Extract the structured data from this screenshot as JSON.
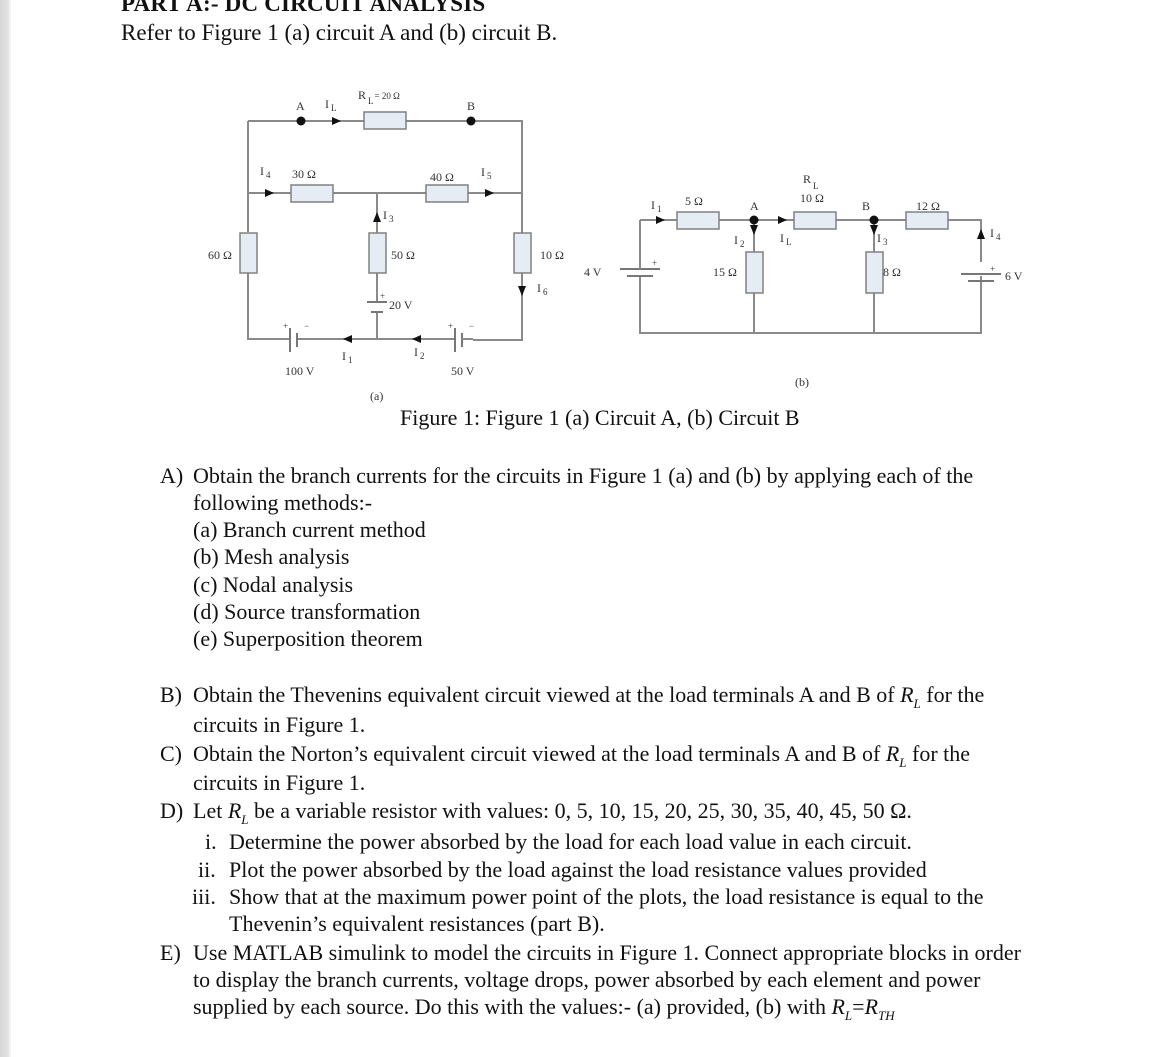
{
  "heading": "PART A:- DC CIRCUIT ANALYSIS",
  "intro": "Refer to Figure 1 (a) circuit A and (b) circuit B.",
  "figure": {
    "caption": "Figure 1: Figure 1 (a) Circuit A, (b) Circuit B",
    "circuit_a": {
      "label": "(a)",
      "nodes": {
        "a": "A",
        "b": "B"
      },
      "rl": {
        "prefix": "R",
        "sub": "L",
        "value": "= 20 Ω"
      },
      "r30": "30 Ω",
      "r40": "40 Ω",
      "r50": "50 Ω",
      "r60": "60 Ω",
      "r10": "10 Ω",
      "v20": "20 V",
      "v100": "100 V",
      "v50": "50 V",
      "currents": {
        "il": {
          "main": "I",
          "sub": "L"
        },
        "i1": {
          "main": "I",
          "sub": "1"
        },
        "i2": {
          "main": "I",
          "sub": "2"
        },
        "i3": {
          "main": "I",
          "sub": "3"
        },
        "i4": {
          "main": "I",
          "sub": "4"
        },
        "i5": {
          "main": "I",
          "sub": "5"
        },
        "i6": {
          "main": "I",
          "sub": "6"
        }
      },
      "plus": "+",
      "minus": "−"
    },
    "circuit_b": {
      "label": "(b)",
      "nodes": {
        "a": "A",
        "b": "B"
      },
      "rl": {
        "prefix": "R",
        "sub": "L",
        "value": "10 Ω"
      },
      "r5": "5 Ω",
      "r15": "15 Ω",
      "r8": "8 Ω",
      "r12": "12 Ω",
      "v4": "4 V",
      "v6": "6 V",
      "currents": {
        "i1": {
          "main": "I",
          "sub": "1"
        },
        "i2": {
          "main": "I",
          "sub": "2"
        },
        "il": {
          "main": "I",
          "sub": "L"
        },
        "i3": {
          "main": "I",
          "sub": "3"
        },
        "i4": {
          "main": "I",
          "sub": "4"
        }
      },
      "plus": "+"
    }
  },
  "questions": {
    "a": {
      "tag": "A)",
      "line1": "Obtain the branch currents for the circuits in Figure 1 (a) and (b) by applying each of the",
      "line2": "following methods:-",
      "methods": [
        "(a) Branch current method",
        "(b) Mesh analysis",
        "(c) Nodal analysis",
        "(d) Source transformation",
        "(e) Superposition theorem"
      ]
    },
    "b": {
      "tag": "B)",
      "line1_pre": "Obtain the Thevenins equivalent circuit viewed at the load terminals A and B of ",
      "line1_post": " for the",
      "line2": "circuits in Figure 1."
    },
    "c": {
      "tag": "C)",
      "line1_pre": "Obtain the Norton’s equivalent circuit viewed at the load terminals A and B of ",
      "line1_post": " for the",
      "line2": "circuits in Figure 1."
    },
    "d": {
      "tag": "D)",
      "line1_pre": "Let ",
      "line1_post": " be a variable resistor with values: 0, 5, 10, 15, 20, 25, 30, 35, 40, 45, 50 Ω.",
      "subitems": [
        {
          "tag": "i.",
          "text": "Determine the power absorbed by the load for each load value in each circuit."
        },
        {
          "tag": "ii.",
          "text": "Plot the power absorbed by the load against the load resistance values provided"
        },
        {
          "tag": "iii.",
          "text": "Show that at the maximum power point of the plots, the load resistance is equal to the",
          "text2": "Thevenin’s equivalent resistances (part B)."
        }
      ]
    },
    "e": {
      "tag": "E)",
      "line1": "Use MATLAB simulink to model the circuits in Figure 1. Connect appropriate blocks in order",
      "line2": "to display the branch currents, voltage drops, power absorbed by each element and power",
      "line3_pre": "supplied by each source. Do this with the values:- (a) provided, (b) with ",
      "eq": "=",
      "rth_sub": "TH"
    },
    "symbol": {
      "r": "R",
      "l": "L"
    }
  }
}
